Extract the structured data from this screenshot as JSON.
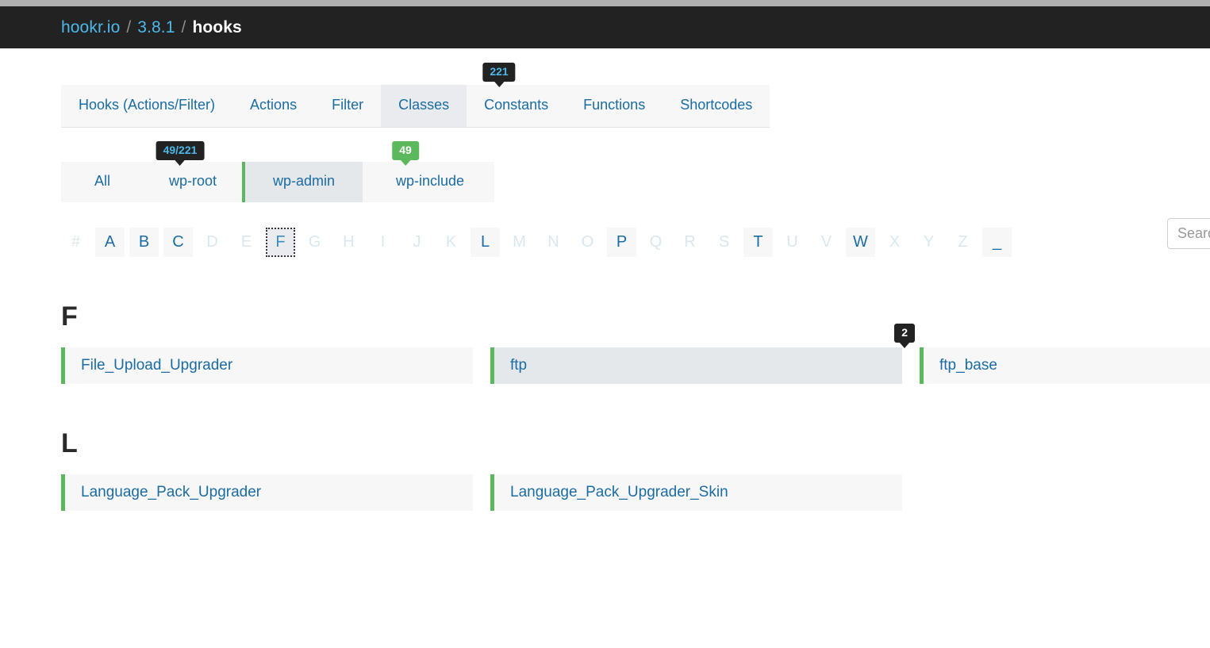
{
  "navbar": {
    "breadcrumb": {
      "site": "hookr.io",
      "sep1": "/",
      "version": "3.8.1",
      "sep2": "/",
      "current": "hooks"
    }
  },
  "tabs": [
    {
      "label": "Hooks (Actions/Filter)",
      "active": false
    },
    {
      "label": "Actions",
      "active": false
    },
    {
      "label": "Filter",
      "active": false
    },
    {
      "label": "Classes",
      "active": true,
      "badge": "221"
    },
    {
      "label": "Constants",
      "active": false
    },
    {
      "label": "Functions",
      "active": false
    },
    {
      "label": "Shortcodes",
      "active": false
    }
  ],
  "subtabs": [
    {
      "label": "All",
      "active": false,
      "badge": "49/221",
      "badge_style": "dark"
    },
    {
      "label": "wp-root",
      "active": false
    },
    {
      "label": "wp-admin",
      "active": true,
      "badge": "49",
      "badge_style": "green"
    },
    {
      "label": "wp-include",
      "active": false
    }
  ],
  "search": {
    "placeholder": "Search",
    "value": ""
  },
  "alphabet": [
    {
      "ch": "#",
      "enabled": false
    },
    {
      "ch": "A",
      "enabled": true
    },
    {
      "ch": "B",
      "enabled": true
    },
    {
      "ch": "C",
      "enabled": true
    },
    {
      "ch": "D",
      "enabled": false
    },
    {
      "ch": "E",
      "enabled": false
    },
    {
      "ch": "F",
      "enabled": true,
      "focused": true
    },
    {
      "ch": "G",
      "enabled": false
    },
    {
      "ch": "H",
      "enabled": false
    },
    {
      "ch": "I",
      "enabled": false
    },
    {
      "ch": "J",
      "enabled": false
    },
    {
      "ch": "K",
      "enabled": false
    },
    {
      "ch": "L",
      "enabled": true
    },
    {
      "ch": "M",
      "enabled": false
    },
    {
      "ch": "N",
      "enabled": false
    },
    {
      "ch": "O",
      "enabled": false
    },
    {
      "ch": "P",
      "enabled": true
    },
    {
      "ch": "Q",
      "enabled": false
    },
    {
      "ch": "R",
      "enabled": false
    },
    {
      "ch": "S",
      "enabled": false
    },
    {
      "ch": "T",
      "enabled": true
    },
    {
      "ch": "U",
      "enabled": false
    },
    {
      "ch": "V",
      "enabled": false
    },
    {
      "ch": "W",
      "enabled": true
    },
    {
      "ch": "X",
      "enabled": false
    },
    {
      "ch": "Y",
      "enabled": false
    },
    {
      "ch": "Z",
      "enabled": false
    },
    {
      "ch": "_",
      "enabled": true
    }
  ],
  "sections": [
    {
      "letter": "F",
      "items": [
        {
          "label": "File_Upload_Upgrader",
          "hover": false
        },
        {
          "label": "ftp",
          "hover": true,
          "badge": "2"
        },
        {
          "label": "ftp_base",
          "hover": false
        }
      ]
    },
    {
      "letter": "L",
      "items": [
        {
          "label": "Language_Pack_Upgrader",
          "hover": false
        },
        {
          "label": "Language_Pack_Upgrader_Skin",
          "hover": false
        }
      ]
    }
  ],
  "colors": {
    "navbar_bg": "#222222",
    "link_blue": "#1b6ca3",
    "accent_cyan": "#4db8e8",
    "accent_green": "#5cb85c",
    "panel_bg": "#f7f7f7",
    "active_bg": "#e9ebee"
  }
}
